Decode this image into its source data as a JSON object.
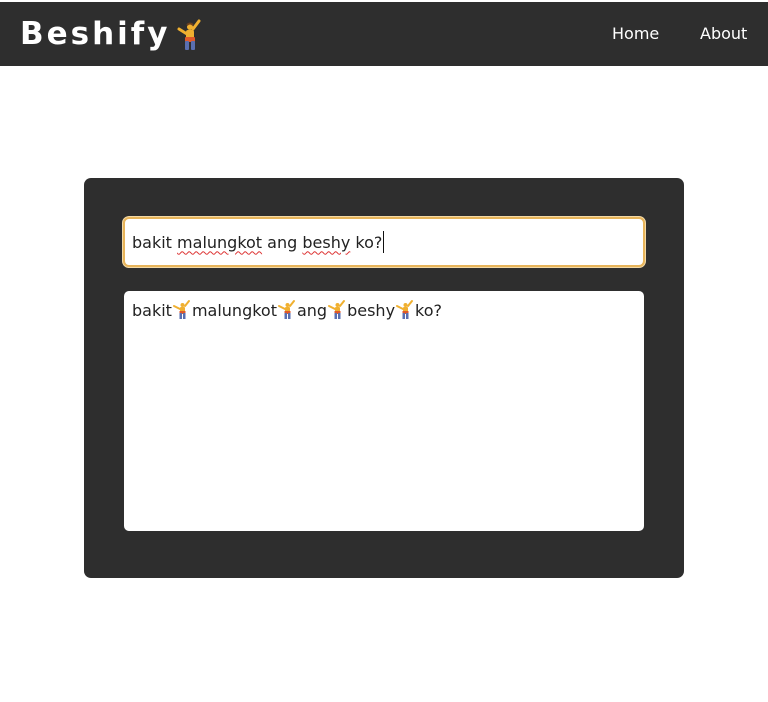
{
  "navbar": {
    "brand": "Beshify",
    "brand_icon": "person-cartwheeling-icon",
    "links": [
      {
        "label": "Home"
      },
      {
        "label": "About"
      }
    ]
  },
  "converter": {
    "input_value": "bakit malungkot ang beshy ko?",
    "input_words": [
      "bakit",
      "malungkot",
      "ang",
      "beshy",
      "ko?"
    ],
    "output_words": [
      "bakit",
      "malungkot",
      "ang",
      "beshy",
      "ko?"
    ],
    "separator_icon": "person-cartwheeling-icon"
  },
  "colors": {
    "navbar_bg": "#2e2e2e",
    "panel_bg": "#2e2e2e",
    "input_focus_border": "#e7b45a"
  }
}
